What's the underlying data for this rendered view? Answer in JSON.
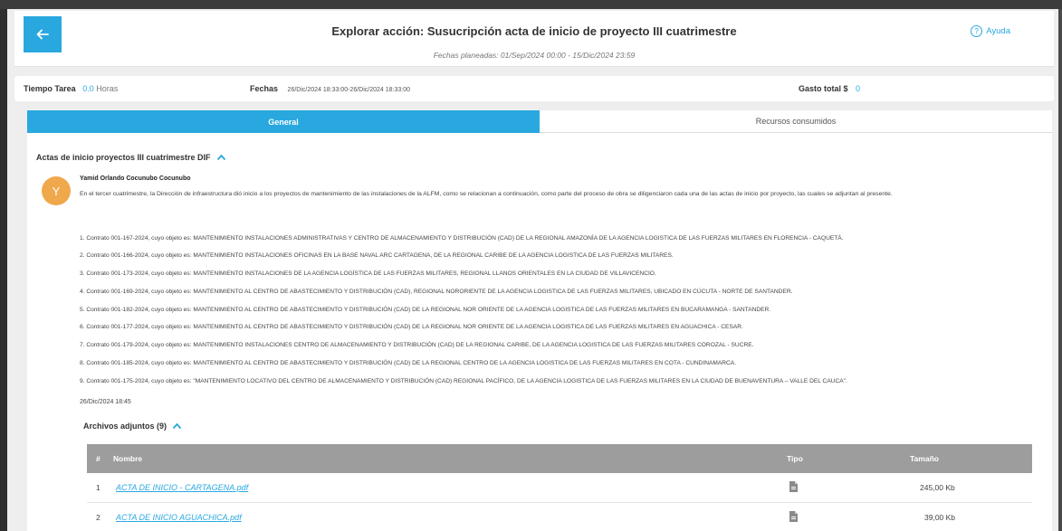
{
  "header": {
    "title": "Explorar acción: Susucripción acta de inicio de proyecto III cuatrimestre",
    "subtitle": "Fechas planeadas: 01/Sep/2024 00:00 - 15/Dic/2024 23:59",
    "help_label": "Ayuda",
    "help_glyph": "?"
  },
  "info": {
    "tiempo_label": "Tiempo Tarea",
    "tiempo_value": "0.0",
    "tiempo_unit": "Horas",
    "fechas_label": "Fechas",
    "fechas_value": "26/Dic/2024 18:33:00-26/Dic/2024 18:33:00",
    "gasto_label": "Gasto total $",
    "gasto_value": "0"
  },
  "tabs": [
    {
      "label": "General",
      "active": true
    },
    {
      "label": "Recursos consumidos",
      "active": false
    }
  ],
  "section": {
    "title": "Actas de inicio proyectos III cuatrimestre DIF",
    "avatar_initial": "Y",
    "author": "Yamid Orlando Cocunubo Cocunubo",
    "intro": "En el tercer cuatrimestre, la Dirección de infraestructura dió inicio a los proyectos de mantenimiento de las instalaciones de la ALFM, como se relacionan a continuación, como parte del proceso de obra se diligenciaron cada una de las actas de inicio por proyecto, las cuales se adjuntan  al presente.",
    "contracts": [
      "1. Contrato 001-167-2024, cuyo objeto es: MANTENIMIENTO INSTALACIONES ADMINISTRATIVAS Y CENTRO DE ALMACENAMIENTO Y DISTRIBUCIÓN (CAD) DE LA REGIONAL AMAZONÍA DE LA AGENCIA LOGISTICA DE LAS FUERZAS MILITARES EN FLORENCIA - CAQUETÁ.",
      "2. Contrato 001-166-2024, cuyo objeto es: MANTENIMIENTO INSTALACIONES OFICINAS EN LA BASE NAVAL ARC CARTAGENA, DE LA REGIONAL CARIBE DE LA AGENCIA LOGISTICA DE LAS FUERZAS MILITARES.",
      "3. Contrato 001-173-2024, cuyo objeto es: MANTENIMIENTO INSTALACIONES DE LA AGENCIA LOGÍSTICA DE LAS FUERZAS MILITARES, REGIONAL LLANOS ORIENTALES EN LA CIUDAD DE VILLAVICENCIO.",
      "4. Contrato 001-169-2024, cuyo objeto es: MANTENIMIENTO AL CENTRO DE ABASTECIMIENTO Y DISTRIBUCIÓN (CAD), REGIONAL NORORIENTE DE LA AGENCIA LOGISTICA DE LAS FUERZAS MILITARES, UBICADO EN CÚCUTA - NORTE DE SANTANDER.",
      "5. Contrato 001-182-2024, cuyo objeto es: MANTENIMIENTO AL CENTRO DE ABASTECIMIENTO Y DISTRIBUCIÓN (CAD) DE LA REGIONAL NOR ORIENTE  DE LA AGENCIA LOGISTICA DE LAS FUERZAS MILITARES EN BUCARAMANGA - SANTANDER.",
      "6. Contrato 001-177-2024, cuyo objeto es: MANTENIMIENTO AL CENTRO DE ABASTECIMIENTO Y DISTRIBUCIÓN (CAD) DE LA REGIONAL NOR ORIENTE  DE LA AGENCIA LOGISTICA DE LAS FUERZAS MILITARES EN AGUACHICA - CESAR.",
      "7. Contrato 001-179-2024, cuyo objeto es: MANTENIMIENTO INSTALACIONES CENTRO DE ALMACENAMIENTO Y DISTRIBUCIÓN (CAD) DE LA REGIONAL CARIBE, DE LA AGENCIA LOGISTICA DE LAS FUERZAS MILITARES COROZAL - SUCRE.",
      "8. Contrato 001-185-2024, cuyo objeto es: MANTENIMIENTO AL CENTRO DE ABASTECIMIENTO Y DISTRIBUCIÓN (CAD) DE LA REGIONAL CENTRO DE LA AGENCIA LOGISTICA DE LAS FUERZAS MILITARES EN COTA - CUNDINAMARCA.",
      "9. Contrato 001-175-2024, cuyo objeto es: \"MANTENIMIENTO LOCATIVO DEL CENTRO DE ALMACENAMIENTO Y DISTRIBUCIÓN (CAD) REGIONAL PACÍFICO, DE LA AGENCIA LOGISTICA DE LAS FUERZAS MILITARES EN LA CIUDAD DE BUENAVENTURA – VALLE DEL CAUCA\"."
    ],
    "date": "26/Dic/2024 18:45"
  },
  "attachments": {
    "title": "Archivos adjuntos (9)",
    "columns": {
      "num": "#",
      "name": "Nombre",
      "type": "Tipo",
      "size": "Tamaño"
    },
    "rows": [
      {
        "num": "1",
        "name": "ACTA DE INICIO - CARTAGENA.pdf",
        "type_icon": "file-icon",
        "size": "245,00 Kb"
      },
      {
        "num": "2",
        "name": "ACTA DE INICIO AGUACHICA.pdf",
        "type_icon": "file-icon",
        "size": "39,00 Kb"
      }
    ]
  },
  "colors": {
    "accent": "#29a8e0",
    "avatar": "#f0a84c",
    "table_header": "#9d9d9d"
  }
}
